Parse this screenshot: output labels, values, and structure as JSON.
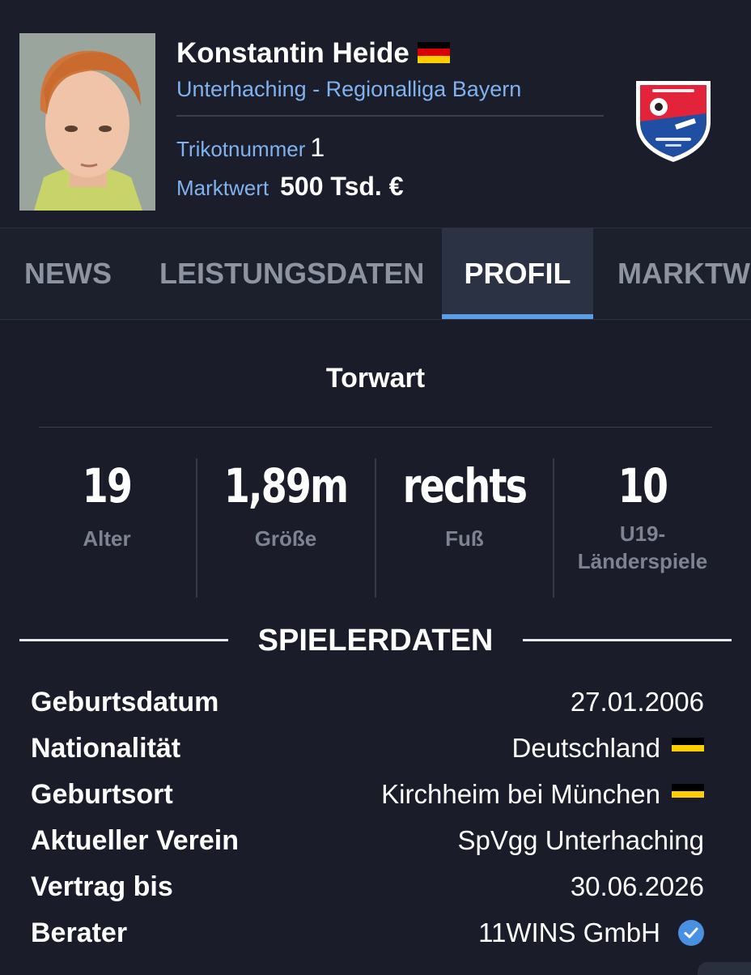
{
  "header": {
    "player_name": "Konstantin Heide",
    "club_league": "Unterhaching - Regionalliga Bayern",
    "jersey_label": "Trikotnummer",
    "jersey_number": "1",
    "market_value_label": "Marktwert",
    "market_value": "500 Tsd. €"
  },
  "tabs": [
    {
      "label": "NEWS",
      "active": false
    },
    {
      "label": "LEISTUNGSDATEN",
      "active": false
    },
    {
      "label": "PROFIL",
      "active": true
    },
    {
      "label": "MARKTWERT",
      "active": false
    }
  ],
  "position": "Torwart",
  "stats": [
    {
      "value": "19",
      "label": "Alter"
    },
    {
      "value": "1,89m",
      "label": "Größe"
    },
    {
      "value": "rechts",
      "label": "Fuß"
    },
    {
      "value": "10",
      "label": "U19-\nLänderspiele"
    }
  ],
  "section_title": "SPIELERDATEN",
  "player_data": [
    {
      "label": "Geburtsdatum",
      "value": "27.01.2006"
    },
    {
      "label": "Nationalität",
      "value": "Deutschland"
    },
    {
      "label": "Geburtsort",
      "value": "Kirchheim bei München"
    },
    {
      "label": "Aktueller Verein",
      "value": "SpVgg Unterhaching"
    },
    {
      "label": "Vertrag bis",
      "value": "30.06.2026"
    },
    {
      "label": "Berater",
      "value": "11WINS GmbH"
    }
  ],
  "colors": {
    "background": "#1a1d29",
    "accent_blue": "#7fb2ee",
    "tab_active_bg": "#2a3243",
    "tab_underline": "#5b9ee6",
    "muted_text": "#7d8392",
    "club_red": "#e2233a",
    "club_blue": "#1f4ea3"
  },
  "icons": {
    "flag": "germany-flag-icon",
    "club_logo": "spvgg-unterhaching-crest",
    "verified": "verified-check-icon"
  }
}
